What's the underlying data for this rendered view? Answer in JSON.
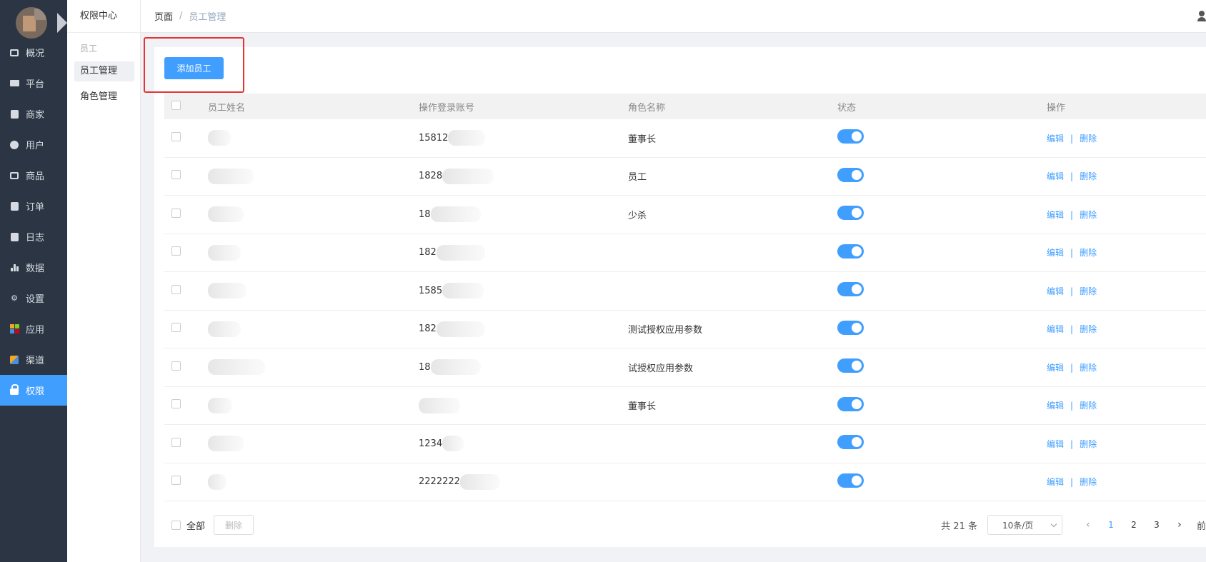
{
  "sidebar": {
    "items": [
      {
        "label": "概况",
        "icon": "dashboard-icon"
      },
      {
        "label": "平台",
        "icon": "monitor-icon"
      },
      {
        "label": "商家",
        "icon": "store-icon"
      },
      {
        "label": "用户",
        "icon": "user-icon"
      },
      {
        "label": "商品",
        "icon": "goods-icon"
      },
      {
        "label": "订单",
        "icon": "clipboard-icon"
      },
      {
        "label": "日志",
        "icon": "book-icon"
      },
      {
        "label": "数据",
        "icon": "bar-chart-icon"
      },
      {
        "label": "设置",
        "icon": "gear-icon"
      },
      {
        "label": "应用",
        "icon": "apps-grid-icon"
      },
      {
        "label": "渠道",
        "icon": "cube-icon"
      },
      {
        "label": "权限",
        "icon": "lock-icon"
      }
    ],
    "active_color": "#409eff"
  },
  "subnav": {
    "title": "权限中心",
    "group": "员工",
    "items": [
      "员工管理",
      "角色管理"
    ]
  },
  "breadcrumb": {
    "root": "页面",
    "separator": "/",
    "current": "员工管理"
  },
  "toolbar": {
    "add_label": "添加员工"
  },
  "table": {
    "headers": [
      "员工姓名",
      "操作登录账号",
      "角色名称",
      "状态",
      "操作"
    ],
    "rows": [
      {
        "account": "15812",
        "role": "董事长"
      },
      {
        "account": "1828",
        "role": "员工"
      },
      {
        "account": "18",
        "role": "少杀"
      },
      {
        "account": "182",
        "role": ""
      },
      {
        "account": "1585",
        "role": ""
      },
      {
        "account": "182",
        "role": "测试授权应用参数"
      },
      {
        "account": "18",
        "role": "试授权应用参数"
      },
      {
        "account": "",
        "role": "董事长"
      },
      {
        "account": "1234",
        "role": ""
      },
      {
        "account": "2222222",
        "role": ""
      }
    ],
    "edit_label": "编辑",
    "op_separator": "|",
    "delete_label": "删除"
  },
  "footer": {
    "select_all": "全部",
    "delete_label": "删除",
    "total": "共 21 条",
    "page_size": "10条/页",
    "pages": [
      "1",
      "2",
      "3"
    ],
    "current_page": "1",
    "goto": "前"
  }
}
